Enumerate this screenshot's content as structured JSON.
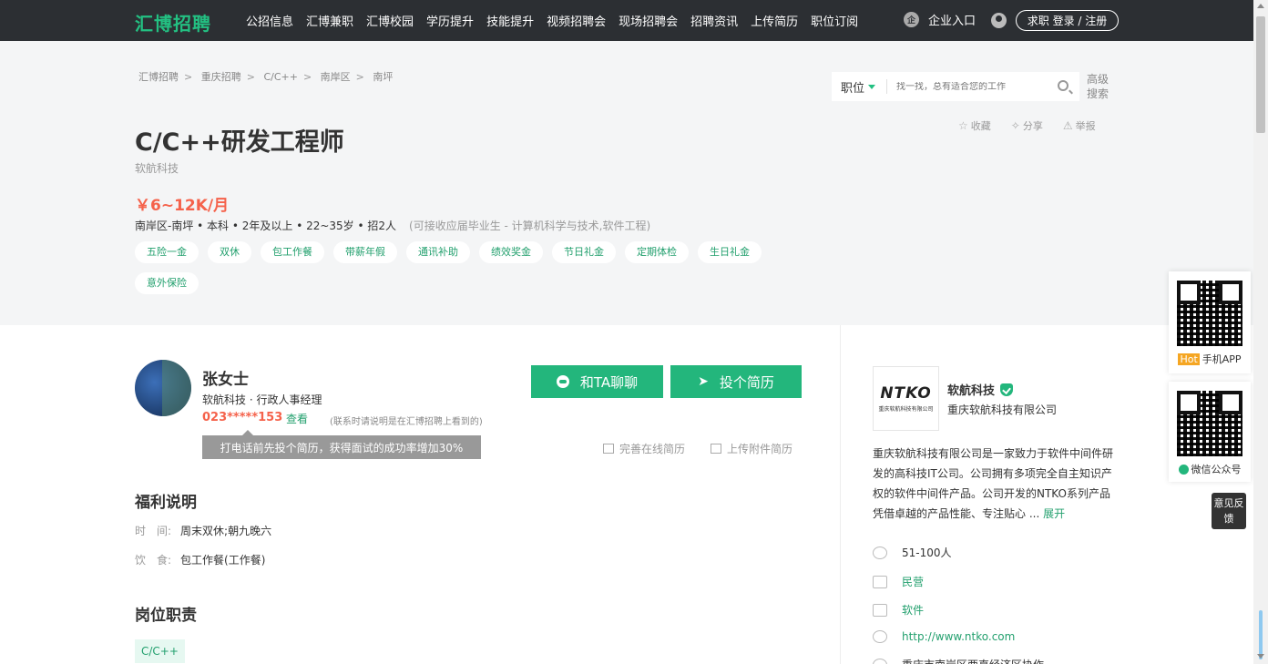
{
  "nav": {
    "logo": "汇博招聘",
    "links": [
      "公招信息",
      "汇博兼职",
      "汇博校园",
      "学历提升",
      "技能提升",
      "视频招聘会",
      "现场招聘会",
      "招聘资讯",
      "上传简历",
      "职位订阅"
    ],
    "enterprise": "企业入口",
    "login": "求职 登录 / 注册"
  },
  "breadcrumb": [
    "汇博招聘",
    "重庆招聘",
    "C/C++",
    "南岸区",
    "南坪"
  ],
  "search": {
    "type": "职位",
    "placeholder": "找一找，总有适合您的工作",
    "advanced": "高级搜索"
  },
  "actions": {
    "favorite": "收藏",
    "share": "分享",
    "report": "举报"
  },
  "job": {
    "title": "C/C++研发工程师",
    "company": "软航科技",
    "salary": "￥6~12K/月",
    "requirements": "南岸区-南坪 • 本科 • 2年及以上 • 22~35岁 • 招2人",
    "requirements_note": "(可接收应届毕业生 - 计算机科学与技术,软件工程)",
    "tags": [
      "五险一金",
      "双休",
      "包工作餐",
      "带薪年假",
      "通讯补助",
      "绩效奖金",
      "节日礼金",
      "定期体检",
      "生日礼金",
      "意外保险"
    ]
  },
  "recruiter": {
    "name": "张女士",
    "title": "软航科技 · 行政人事经理",
    "phone": "023*****153",
    "view": "查看",
    "phone_note": "(联系时请说明是在汇博招聘上看到的)",
    "tip": "打电话前先投个简历，获得面试的成功率增加30%",
    "chat_button": "和TA聊聊",
    "apply_button": "投个简历",
    "online_resume": "完善在线简历",
    "upload_resume": "上传附件简历"
  },
  "benefits": {
    "title": "福利说明",
    "rows": [
      {
        "label": "时　间:",
        "value": "周末双休;朝九晚六"
      },
      {
        "label": "饮　食:",
        "value": "包工作餐(工作餐)"
      }
    ]
  },
  "duties": {
    "title": "岗位职责",
    "tag": "C/C++"
  },
  "company": {
    "logo_text": "NTKO",
    "logo_sub": "重庆软航科技有限公司",
    "short_name": "软航科技",
    "full_name": "重庆软航科技有限公司",
    "description": "重庆软航科技有限公司是一家致力于软件中间件研发的高科技IT公司。公司拥有多项完全自主知识产权的软件中间件产品。公司开发的NTKO系列产品凭借卓越的产品性能、专注贴心 ...",
    "expand": "展开",
    "size": "51-100人",
    "nature": "民营",
    "industry": "软件",
    "website": "http://www.ntko.com",
    "address": "重庆市南岸区两直经济区协作"
  },
  "float": {
    "app_label": "手机APP",
    "hot": "Hot",
    "wechat_label": "微信公众号",
    "feedback": "意见反馈"
  }
}
